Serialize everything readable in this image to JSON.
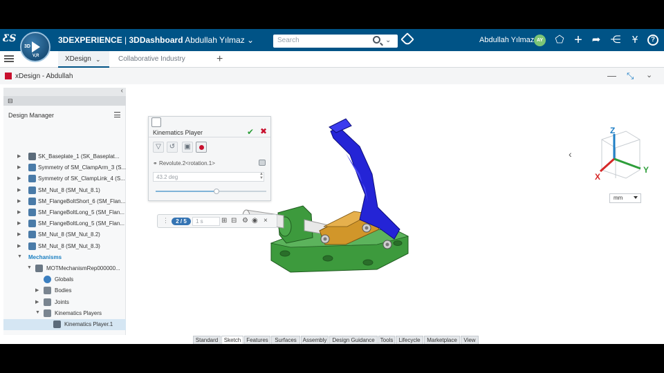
{
  "topbar": {
    "brand_product": "3DEXPERIENCE",
    "brand_sep": " | ",
    "brand_app": "3DDashboard",
    "brand_user": "Abdullah Yılmaz",
    "search_placeholder": "Search",
    "user_name": "Abdullah Yılmaz",
    "avatar_initials": "AY",
    "compass_top": "3D",
    "compass_bottom": "V,R"
  },
  "tabs": {
    "active": "XDesign",
    "second": "Collaborative Industry Innnovator"
  },
  "window": {
    "title": "xDesign - Abdullah"
  },
  "tree": {
    "header_label": "Design Manager",
    "rows": [
      {
        "label": "SK_Baseplate_1 (SK_Baseplat...",
        "kind": "sketch"
      },
      {
        "label": "Symmetry of SM_ClampArm_3 (S...",
        "kind": "part"
      },
      {
        "label": "Symmetry of SK_ClampLink_4 (S...",
        "kind": "part"
      },
      {
        "label": "SM_Nut_8 (SM_Nut_8.1)",
        "kind": "part"
      },
      {
        "label": "SM_FlangeBoltShort_6 (SM_Flan...",
        "kind": "part"
      },
      {
        "label": "SM_FlangeBoltLong_5 (SM_Flan...",
        "kind": "part"
      },
      {
        "label": "SM_FlangeBoltLong_5 (SM_Flan...",
        "kind": "part"
      },
      {
        "label": "SM_Nut_8 (SM_Nut_8.2)",
        "kind": "part"
      },
      {
        "label": "SM_Nut_8 (SM_Nut_8.3)",
        "kind": "part"
      },
      {
        "label": "Mechanisms",
        "kind": "section"
      },
      {
        "label": "MOTMechanismRep000000...",
        "kind": "mech"
      },
      {
        "label": "Globals",
        "kind": "globe"
      },
      {
        "label": "Bodies",
        "kind": "folder"
      },
      {
        "label": "Joints",
        "kind": "folder"
      },
      {
        "label": "Kinematics Players",
        "kind": "folder"
      },
      {
        "label": "Kinematics Player.1",
        "kind": "player"
      }
    ]
  },
  "kinematics_player": {
    "title": "Kinematics Player",
    "joint": "Revolute.2<rotation.1>",
    "value": "43.2 deg",
    "slider_fraction": 0.55
  },
  "player_controls": {
    "frame": "2 / 5",
    "duration": "1 s"
  },
  "viewport": {
    "unit": "mm",
    "axis_x": "X",
    "axis_y": "Y",
    "axis_z": "Z"
  },
  "bottom_tabs": [
    "Standard",
    "Sketch",
    "Features",
    "Surfaces",
    "Assembly",
    "Design Guidance",
    "Tools",
    "Lifecycle",
    "Marketplace",
    "View"
  ],
  "bottom_active_tab": "Sketch",
  "colors": {
    "topbar": "#005386",
    "clamp_arm": "#2424d6",
    "base": "#3d9a3d",
    "link": "#d1962a",
    "axis_x": "#d62828",
    "axis_y": "#2e9e3a",
    "axis_z": "#1f7fc6"
  }
}
